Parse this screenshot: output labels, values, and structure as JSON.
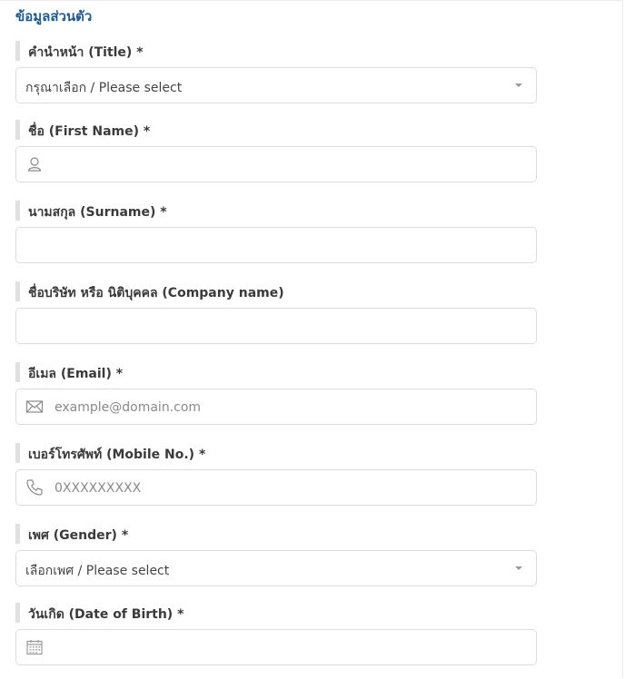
{
  "section": {
    "title": "ข้อมูลส่วนตัว"
  },
  "fields": {
    "title": {
      "label": "คำนำหน้า (Title) *",
      "value": "กรุณาเลือก / Please select"
    },
    "first_name": {
      "label": "ชื่อ (First Name) *",
      "placeholder": ""
    },
    "surname": {
      "label": "นามสกุล (Surname) *",
      "placeholder": ""
    },
    "company": {
      "label": "ชื่อบริษัท หรือ นิติบุคคล (Company name)",
      "placeholder": ""
    },
    "email": {
      "label": "อีเมล (Email) *",
      "placeholder": "example@domain.com"
    },
    "mobile": {
      "label": "เบอร์โทรศัพท์ (Mobile No.) *",
      "placeholder": "0XXXXXXXXX"
    },
    "gender": {
      "label": "เพศ (Gender) *",
      "value": "เลือกเพศ / Please select"
    },
    "dob": {
      "label": "วันเกิด (Date of Birth) *",
      "placeholder": ""
    }
  },
  "icons": {
    "first_name": "user-icon",
    "email": "envelope-icon",
    "mobile": "phone-icon",
    "dob": "calendar-icon",
    "dropdown": "chevron-down-icon"
  },
  "colors": {
    "section_title": "#1f5a8f",
    "label_bar": "#e0e0e0",
    "border": "#dcdcdc"
  }
}
